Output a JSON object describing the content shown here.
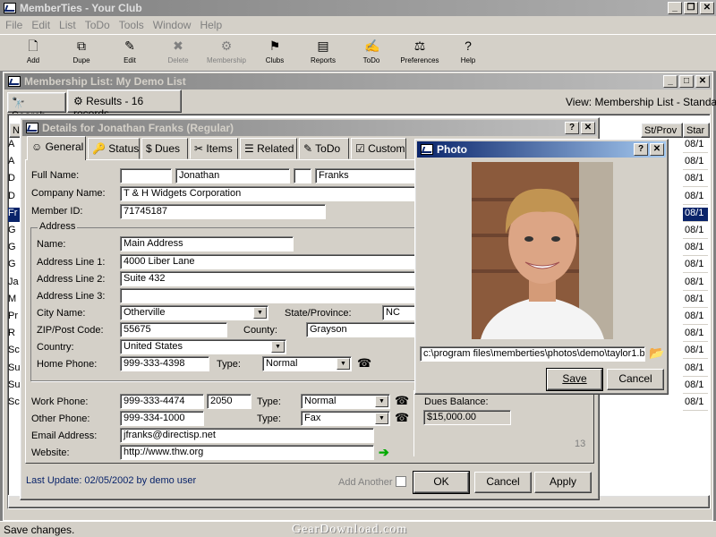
{
  "app": {
    "title": "MemberTies - Your Club"
  },
  "menu": [
    "File",
    "Edit",
    "List",
    "ToDo",
    "Tools",
    "Window",
    "Help"
  ],
  "toolbar": [
    {
      "label": "Add",
      "icon": "new-doc-icon"
    },
    {
      "label": "Dupe",
      "icon": "copy-icon"
    },
    {
      "label": "Edit",
      "icon": "edit-icon"
    },
    {
      "label": "Delete",
      "icon": "delete-icon"
    },
    {
      "label": "Membership",
      "icon": "membership-icon"
    },
    {
      "label": "Clubs",
      "icon": "flag-icon"
    },
    {
      "label": "Reports",
      "icon": "reports-icon"
    },
    {
      "label": "ToDo",
      "icon": "todo-icon"
    },
    {
      "label": "Preferences",
      "icon": "preferences-icon"
    },
    {
      "label": "Help",
      "icon": "help-icon"
    }
  ],
  "list_window": {
    "title": "Membership List: My Demo List",
    "search_tab": "Search",
    "results_tab": "Results - 16 records",
    "view": "View: Membership List - Standard",
    "col_n": "N",
    "col_stprov": "St/Prov",
    "col_star": "Star",
    "row_letters": [
      "A",
      "A",
      "D",
      "D",
      "Fr",
      "G",
      "G",
      "G",
      "Ja",
      "M",
      "Pr",
      "R",
      "Sc",
      "Su",
      "Su",
      "Sc"
    ],
    "row_prov": [
      "08/1",
      "08/1",
      "08/1",
      "08/1",
      "08/1",
      "08/1",
      "08/1",
      "08/1",
      "08/1",
      "08/1",
      "08/1",
      "08/1",
      "08/1",
      "08/1",
      "08/1",
      "08/1"
    ]
  },
  "details": {
    "title": "Details for Jonathan Franks (Regular)",
    "tabs": [
      "General",
      "Status",
      "Dues",
      "Items",
      "Related",
      "ToDo",
      "Custom"
    ],
    "labels": {
      "full_name": "Full Name:",
      "company": "Company Name:",
      "member_id": "Member ID:",
      "address_group": "Address",
      "name": "Name:",
      "line1": "Address Line 1:",
      "line2": "Address Line 2:",
      "line3": "Address Line 3:",
      "city": "City Name:",
      "state": "State/Province:",
      "zip": "ZIP/Post Code:",
      "county": "County:",
      "country": "Country:",
      "home_phone": "Home Phone:",
      "type": "Type:",
      "work_phone": "Work Phone:",
      "other_phone": "Other Phone:",
      "email": "Email Address:",
      "website": "Website:",
      "dues_balance": "Dues Balance:"
    },
    "values": {
      "first": "Jonathan",
      "last": "Franks",
      "company": "T & H Widgets Corporation",
      "member_id": "71745187",
      "name": "Main Address",
      "line1": "4000 Liber Lane",
      "line2": "Suite 432",
      "line3": "",
      "city": "Otherville",
      "state": "NC",
      "zip": "55675",
      "county": "Grayson",
      "country": "United States",
      "home_phone": "999-333-4398",
      "home_type": "Normal",
      "work_phone": "999-333-4474",
      "work_ext": "2050",
      "work_type": "Normal",
      "other_phone": "999-334-1000",
      "other_type": "Fax",
      "email": "jfranks@directisp.net",
      "website": "http://www.thw.org",
      "dues_balance": "$15,000.00",
      "count": "13"
    },
    "last_update": "Last Update:  02/05/2002 by demo user",
    "add_another": "Add Another",
    "ok": "OK",
    "cancel": "Cancel",
    "apply": "Apply"
  },
  "photo": {
    "title": "Photo",
    "path": "c:\\program files\\memberties\\photos\\demo\\taylor1.bmp",
    "save": "Save",
    "cancel": "Cancel"
  },
  "status": {
    "text": "Save changes.",
    "watermark": "GearDownload.com"
  }
}
